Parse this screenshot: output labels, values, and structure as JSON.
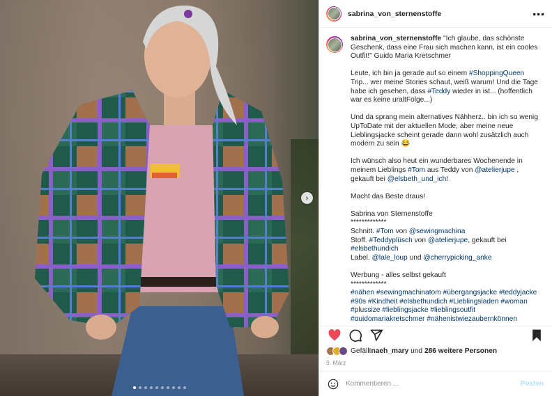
{
  "header": {
    "username": "sabrina_von_sternenstoffe",
    "more_icon": "more-horizontal-icon"
  },
  "caption": {
    "username": "sabrina_von_sternenstoffe",
    "quote": " \"Ich glaube, das schönste Geschenk, dass eine Frau sich machen kann, ist ein cooles Outfit!\" Guido Maria Kretschmer",
    "p2_a": "Leute, ich bin ja gerade auf so einem ",
    "p2_tag1": "#ShoppingQueen",
    "p2_b": " Trip... wer meine Stories schaut, weiß warum! Und die Tage habe ich gesehen, dass ",
    "p2_tag2": "#Teddy",
    "p2_c": " wieder in ist... (hoffentlich war es keine uraltFolge...)",
    "p3": "Und da sprang mein alternatives Nähherz.. bin ich so wenig UpToDate mit der aktuellen Mode, aber meine neue Lieblingsjacke scheint gerade dann wohl zusätzlich auch modern zu sein 😂",
    "p4_a": "Ich wünsch also heut ein wunderbares Wochenende in meinem Lieblings ",
    "p4_tag": "#Tom",
    "p4_b": " aus Teddy von ",
    "p4_m1": "@atelierjupe",
    "p4_c": " , gekauft bei ",
    "p4_m2": "@elsbeth_und_ich",
    "p4_d": "!",
    "p5": "Macht das Beste draus!",
    "p6_name": "Sabrina von Sternenstoffe",
    "p6_stars": "*************",
    "p6_schnitt": "Schnitt. ",
    "p6_tom": "#Tom",
    "p6_von": " von ",
    "p6_sm": "@sewingmachina",
    "p6_stoff": "Stoff. ",
    "p6_tp": "#Teddyplüsch",
    "p6_von2": " von ",
    "p6_aj": "@atelierjupe",
    "p6_gek": ", gekauft bei ",
    "p6_eu": "#elsbethundich",
    "p6_label": "Label. ",
    "p6_ll": "@lale_loup",
    "p6_und": " und ",
    "p6_ca": "@cherrypicking_anke",
    "p7_title": "Werbung - alles selbst gekauft",
    "p7_stars": "*************",
    "hashtags": "#nähen #sewingmachinatom #übergangsjacke #teddyjacke #90s #Kindheit #elsbethundich #Lieblingsladen #woman #plussize #lieblingsjacke #lieblingsoutfit #guidomariakretschmer #nähenistwiezaubernkönnen #nähenistmeinesuperkraft #sewing #ilovetosew #handmade"
  },
  "actions": {
    "like_icon": "heart-filled-icon",
    "comment_icon": "comment-icon",
    "share_icon": "send-icon",
    "save_icon": "bookmark-filled-icon",
    "like_color": "#ed4956"
  },
  "likes": {
    "prefix": "Gefällt ",
    "user": "naeh_mary",
    "mid": " und ",
    "count": "286 weitere Personen"
  },
  "date": "9. März",
  "comment": {
    "placeholder": "Kommentieren ...",
    "post_label": "Posten",
    "emoji_icon": "emoji-icon"
  },
  "carousel": {
    "dots": 10,
    "active_index": 0,
    "next_icon": "chevron-right-icon"
  }
}
